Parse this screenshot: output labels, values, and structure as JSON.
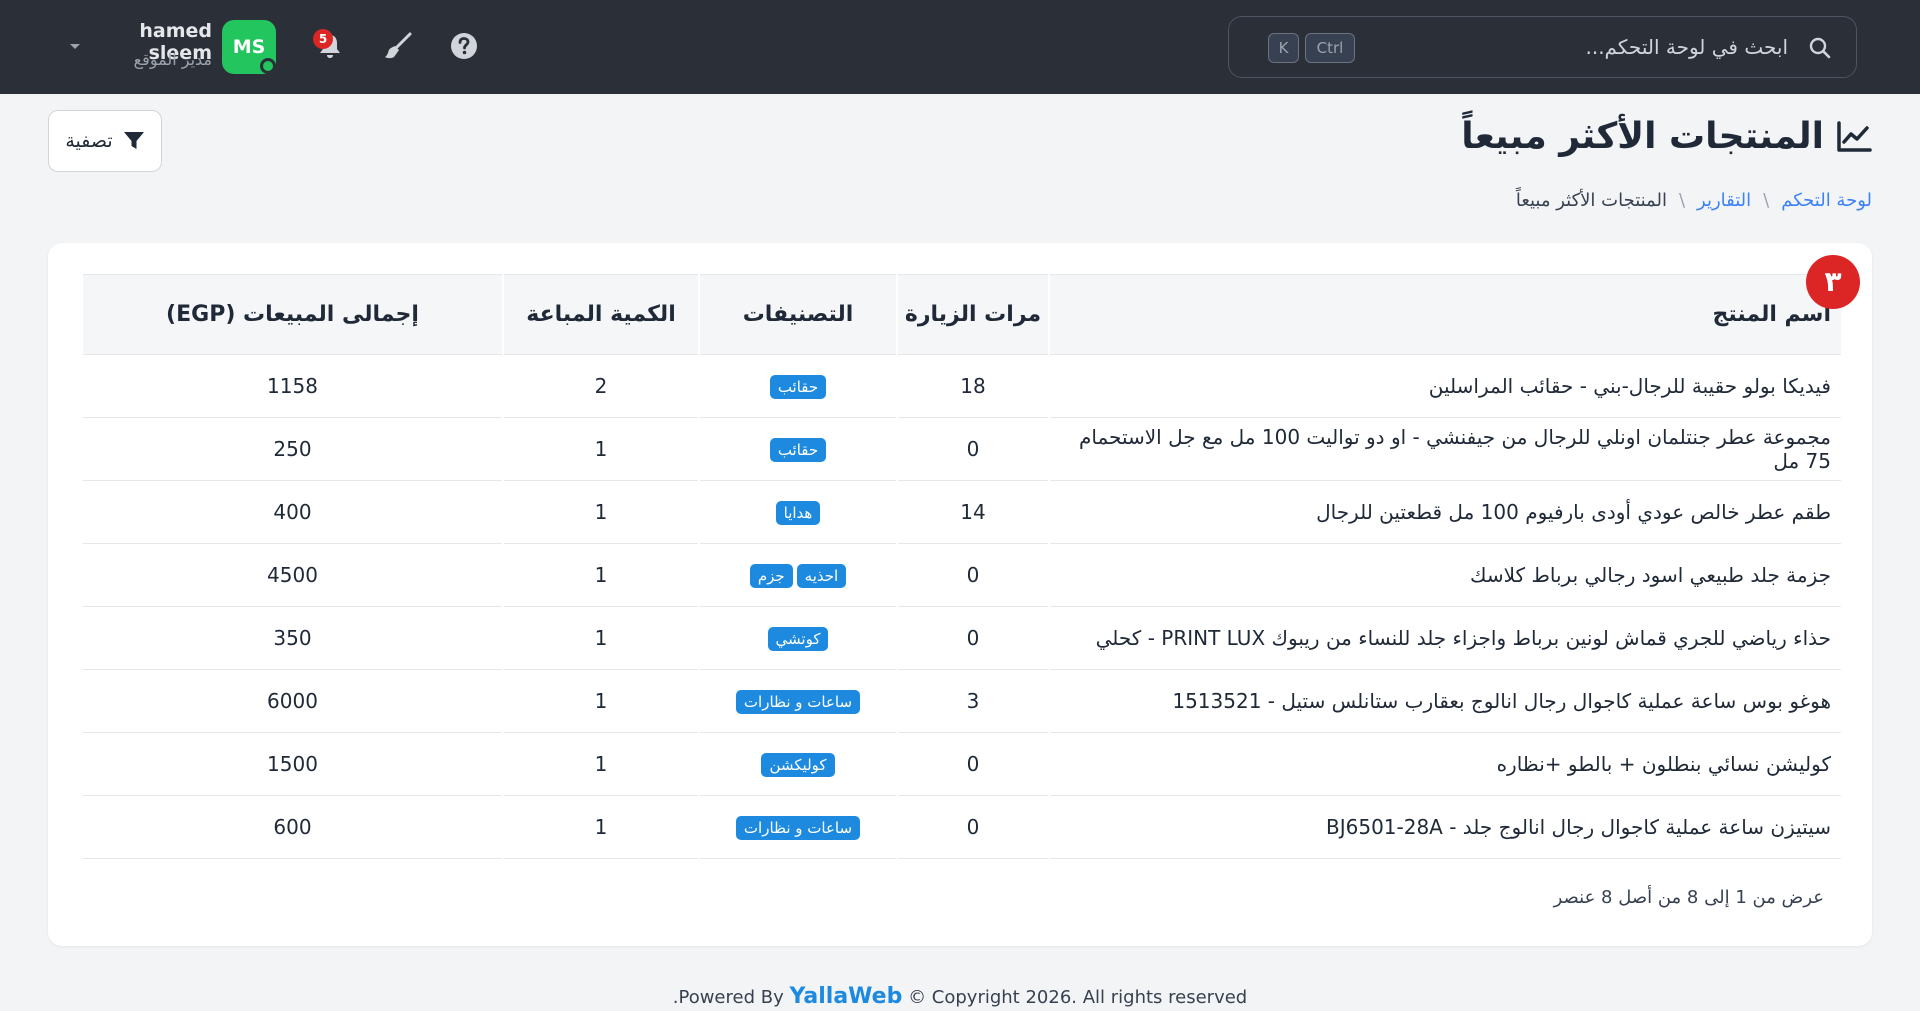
{
  "topbar": {
    "search": {
      "placeholder": "ابحث في لوحة التحكم...",
      "kbd_ctrl": "Ctrl",
      "kbd_k": "K"
    },
    "notifications_count": "5",
    "user": {
      "initials": "MS",
      "name": "hamed sleem",
      "role": "مدير الموقع"
    },
    "icons": [
      "search-icon",
      "help-icon",
      "brush-icon",
      "bell-icon",
      "chevron-down-icon"
    ]
  },
  "header": {
    "title": "المنتجات الأكثر مبيعاً",
    "filter_label": "تصفية",
    "breadcrumb": {
      "home": "لوحة التحكم",
      "separator": "\\",
      "reports": "التقارير",
      "current": "المنتجات الأكثر مبيعاً"
    }
  },
  "table": {
    "badge": "٣",
    "columns": {
      "name": "اسم المنتج",
      "visits": "مرات الزيارة",
      "categories": "التصنيفات",
      "qty": "الكمية المباعة",
      "total": "إجمالى المبيعات (EGP)"
    },
    "rows": [
      {
        "name": "فيديكا بولو حقيبة للرجال-بني - حقائب المراسلين",
        "visits": "18",
        "categories": [
          "حقائب"
        ],
        "qty": "2",
        "total": "1158"
      },
      {
        "name": "مجموعة عطر جنتلمان اونلي للرجال من جيفنشي - او دو تواليت 100 مل مع جل الاستحمام 75 مل",
        "visits": "0",
        "categories": [
          "حقائب"
        ],
        "qty": "1",
        "total": "250"
      },
      {
        "name": "طقم عطر خالص عودي أودى بارفيوم 100 مل قطعتين للرجال",
        "visits": "14",
        "categories": [
          "هدايا"
        ],
        "qty": "1",
        "total": "400"
      },
      {
        "name": "جزمة جلد طبيعي اسود رجالي برباط كلاسك",
        "visits": "0",
        "categories": [
          "احذيه",
          "جزم"
        ],
        "qty": "1",
        "total": "4500"
      },
      {
        "name": "حذاء رياضي للجري قماش لونين برباط واجزاء جلد للنساء من ريبوك PRINT LUX - كحلي",
        "visits": "0",
        "categories": [
          "كوتشي"
        ],
        "qty": "1",
        "total": "350"
      },
      {
        "name": "هوغو بوس ساعة عملية كاجوال رجال انالوج بعقارب ستانلس ستيل - 1513521",
        "visits": "3",
        "categories": [
          "ساعات و نظارات"
        ],
        "qty": "1",
        "total": "6000"
      },
      {
        "name": "كوليشن نسائي بنطلون + بالطو +نظاره",
        "visits": "0",
        "categories": [
          "كوليكشن"
        ],
        "qty": "1",
        "total": "1500"
      },
      {
        "name": "سيتيزن ساعة عملية كاجوال رجال انالوج جلد - BJ6501-28A",
        "visits": "0",
        "categories": [
          "ساعات و نظارات"
        ],
        "qty": "1",
        "total": "600"
      }
    ],
    "info": "عرض من 1 إلى 8 من أصل 8 عنصر"
  },
  "footer": {
    "powered_by": ".Powered By",
    "brand": "YallaWeb",
    "copyright": "© Copyright 2026. All rights reserved"
  },
  "colors": {
    "topbar": "#2b3038",
    "accent": "#1d8ae0",
    "link": "#3b82f6",
    "avatar": "#22c55e",
    "badge": "#dc2626"
  }
}
